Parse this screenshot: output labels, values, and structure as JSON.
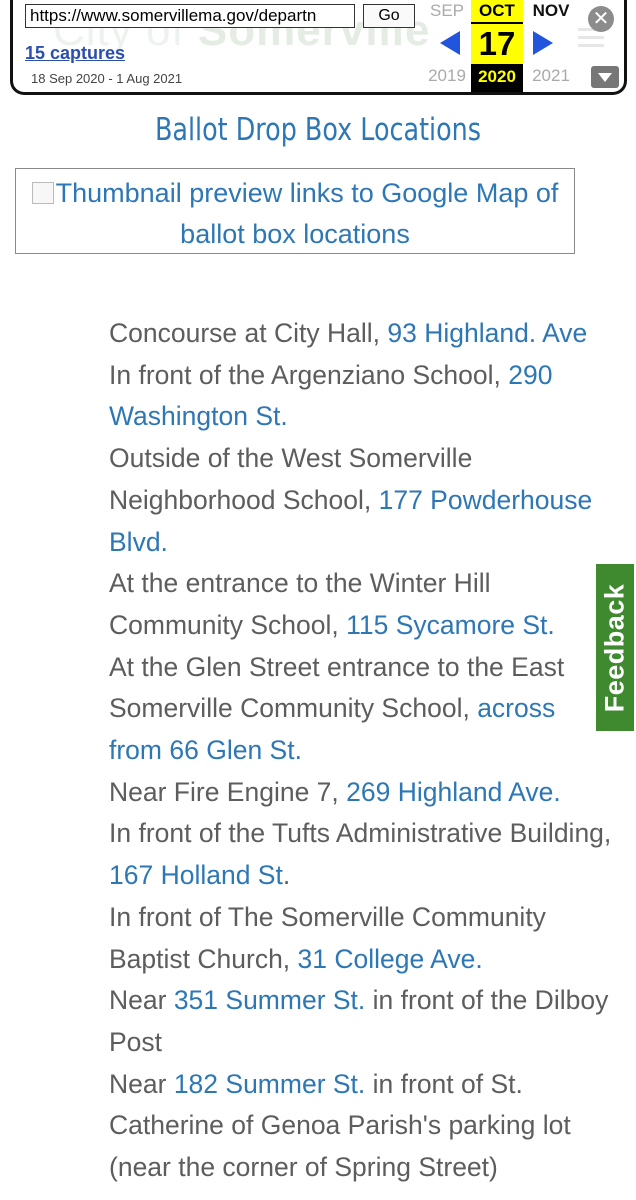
{
  "wayback": {
    "url_value": "https://www.somervillema.gov/departn",
    "go_label": "Go",
    "captures_label": "15 captures",
    "date_range": "18 Sep 2020 - 1 Aug 2021",
    "prev_month": "SEP",
    "current_month": "OCT",
    "next_month": "NOV",
    "current_day": "17",
    "prev_year": "2019",
    "current_year": "2020",
    "next_year": "2021",
    "ghost_title_a": "City of ",
    "ghost_title_b": "Somerville",
    "highlight_color": "#ffff00",
    "arrow_color": "#2255dd"
  },
  "page": {
    "heading": "Ballot Drop Box Locations",
    "thumbnail_alt": "Thumbnail preview links to Google Map of ballot box locations",
    "link_color": "#2e77b5",
    "text_color": "#5d5d5d"
  },
  "locations": [
    {
      "before": "Concourse at City Hall, ",
      "link": "93 Highland. Ave",
      "after": ""
    },
    {
      "before": "In front of the Argenziano School, ",
      "link": "290 Washington St.",
      "after": ""
    },
    {
      "before": "Outside of the West Somerville Neighborhood School, ",
      "link": "177 Powderhouse Blvd.",
      "after": ""
    },
    {
      "before": "At the entrance to the Winter Hill Community School, ",
      "link": "115 Sycamore St.",
      "after": ""
    },
    {
      "before": "At the Glen Street entrance to the East Somerville Community School, ",
      "link": "across from 66 Glen St.",
      "after": ""
    },
    {
      "before": "Near Fire Engine 7, ",
      "link": "269 Highland Ave.",
      "after": ""
    },
    {
      "before": "In front of the Tufts Administrative Building, ",
      "link": "167 Holland St",
      "after": "."
    },
    {
      "before": "In front of The Somerville Community Baptist Church, ",
      "link": "31 College Ave.",
      "after": ""
    },
    {
      "before": "Near ",
      "link": "351 Summer St.",
      "after": " in front of the Dilboy Post"
    },
    {
      "before": "Near ",
      "link": "182 Summer St.",
      "after": " in front of St. Catherine of Genoa Parish's parking lot (near the corner of Spring Street)"
    }
  ],
  "feedback": {
    "label": "Feedback",
    "color": "#3f8a2f"
  }
}
